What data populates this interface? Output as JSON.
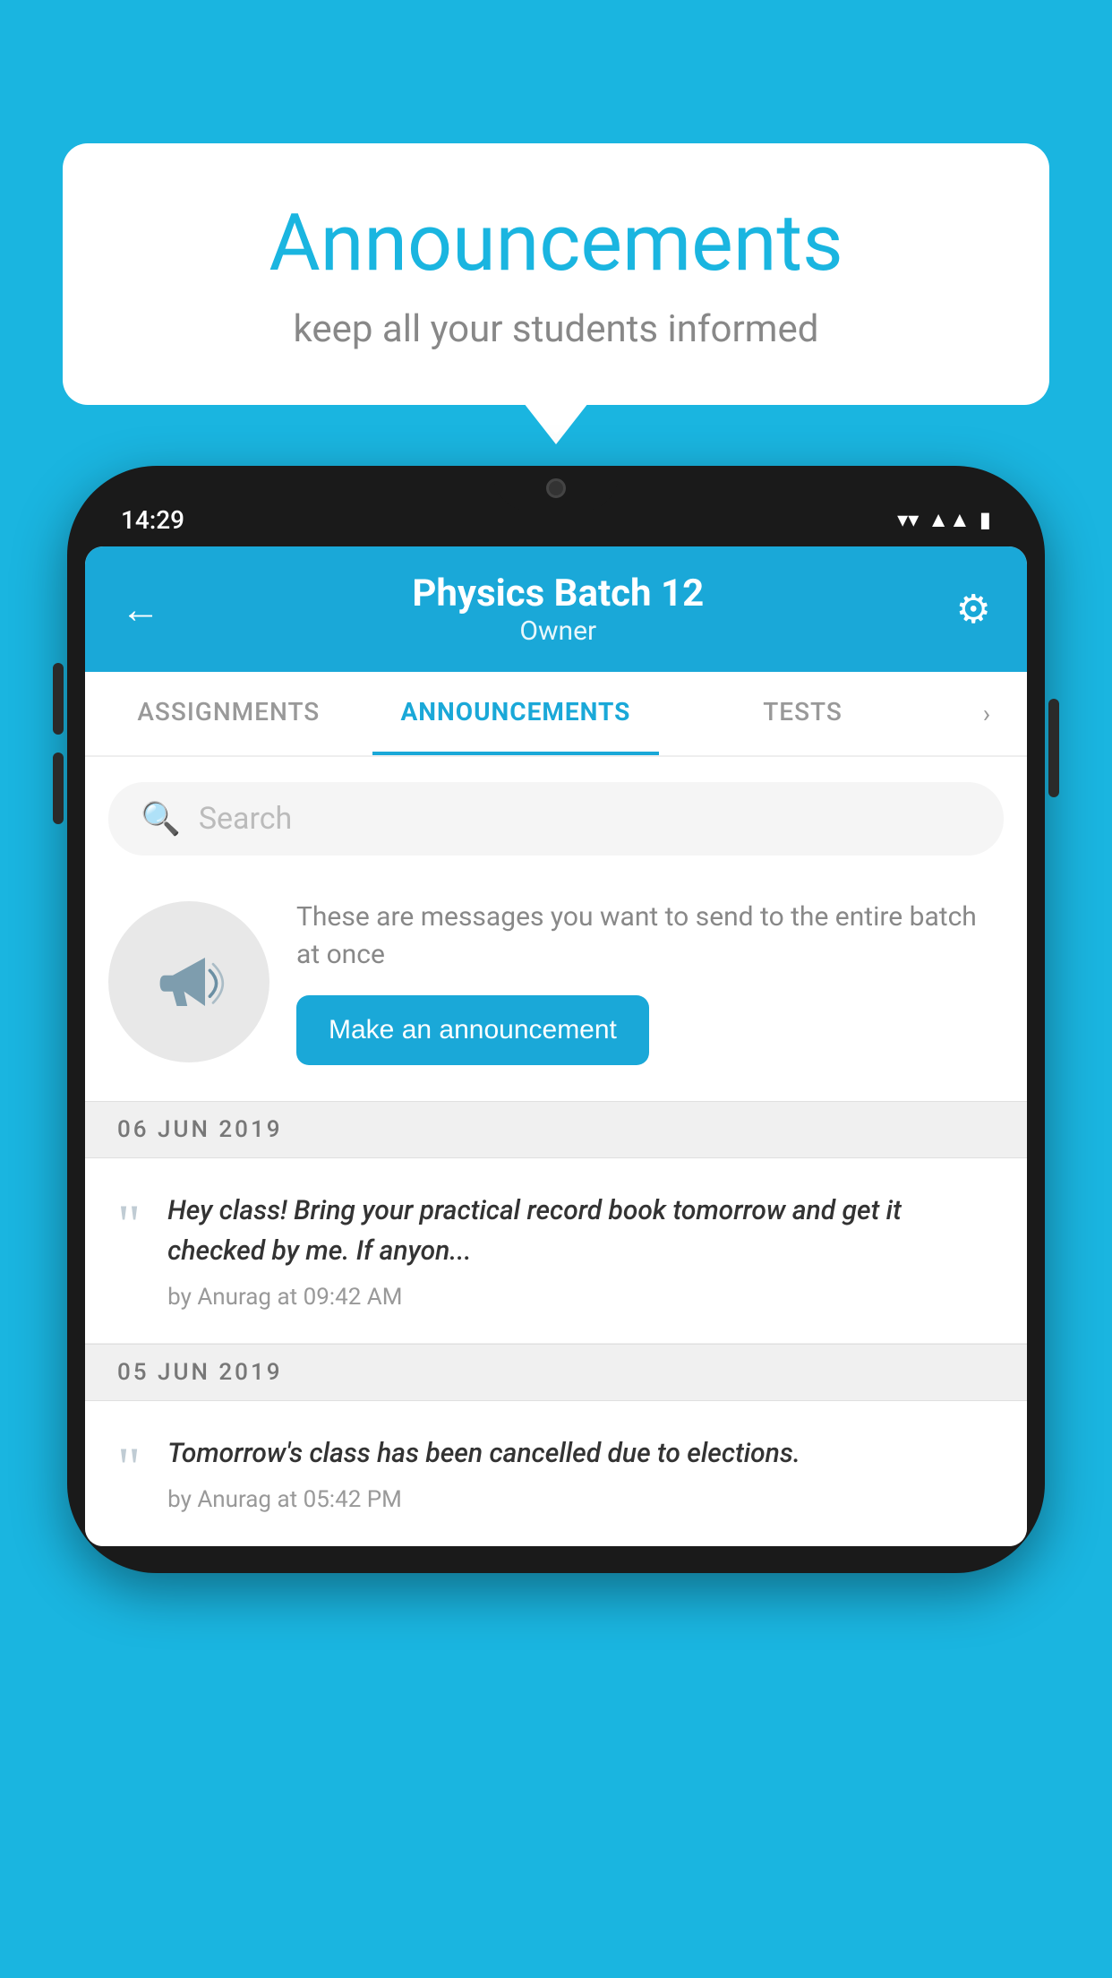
{
  "page": {
    "background_color": "#1ab5e0"
  },
  "speech_bubble": {
    "title": "Announcements",
    "subtitle": "keep all your students informed"
  },
  "phone": {
    "status_bar": {
      "time": "14:29"
    },
    "header": {
      "title": "Physics Batch 12",
      "subtitle": "Owner",
      "back_label": "←",
      "settings_label": "⚙"
    },
    "tabs": [
      {
        "label": "ASSIGNMENTS",
        "active": false
      },
      {
        "label": "ANNOUNCEMENTS",
        "active": true
      },
      {
        "label": "TESTS",
        "active": false
      }
    ],
    "search": {
      "placeholder": "Search"
    },
    "promo": {
      "description": "These are messages you want to send to the entire batch at once",
      "button_label": "Make an announcement"
    },
    "announcements": [
      {
        "date": "06  JUN  2019",
        "text": "Hey class! Bring your practical record book tomorrow and get it checked by me. If anyon...",
        "author": "by Anurag at 09:42 AM"
      },
      {
        "date": "05  JUN  2019",
        "text": "Tomorrow's class has been cancelled due to elections.",
        "author": "by Anurag at 05:42 PM"
      }
    ]
  }
}
